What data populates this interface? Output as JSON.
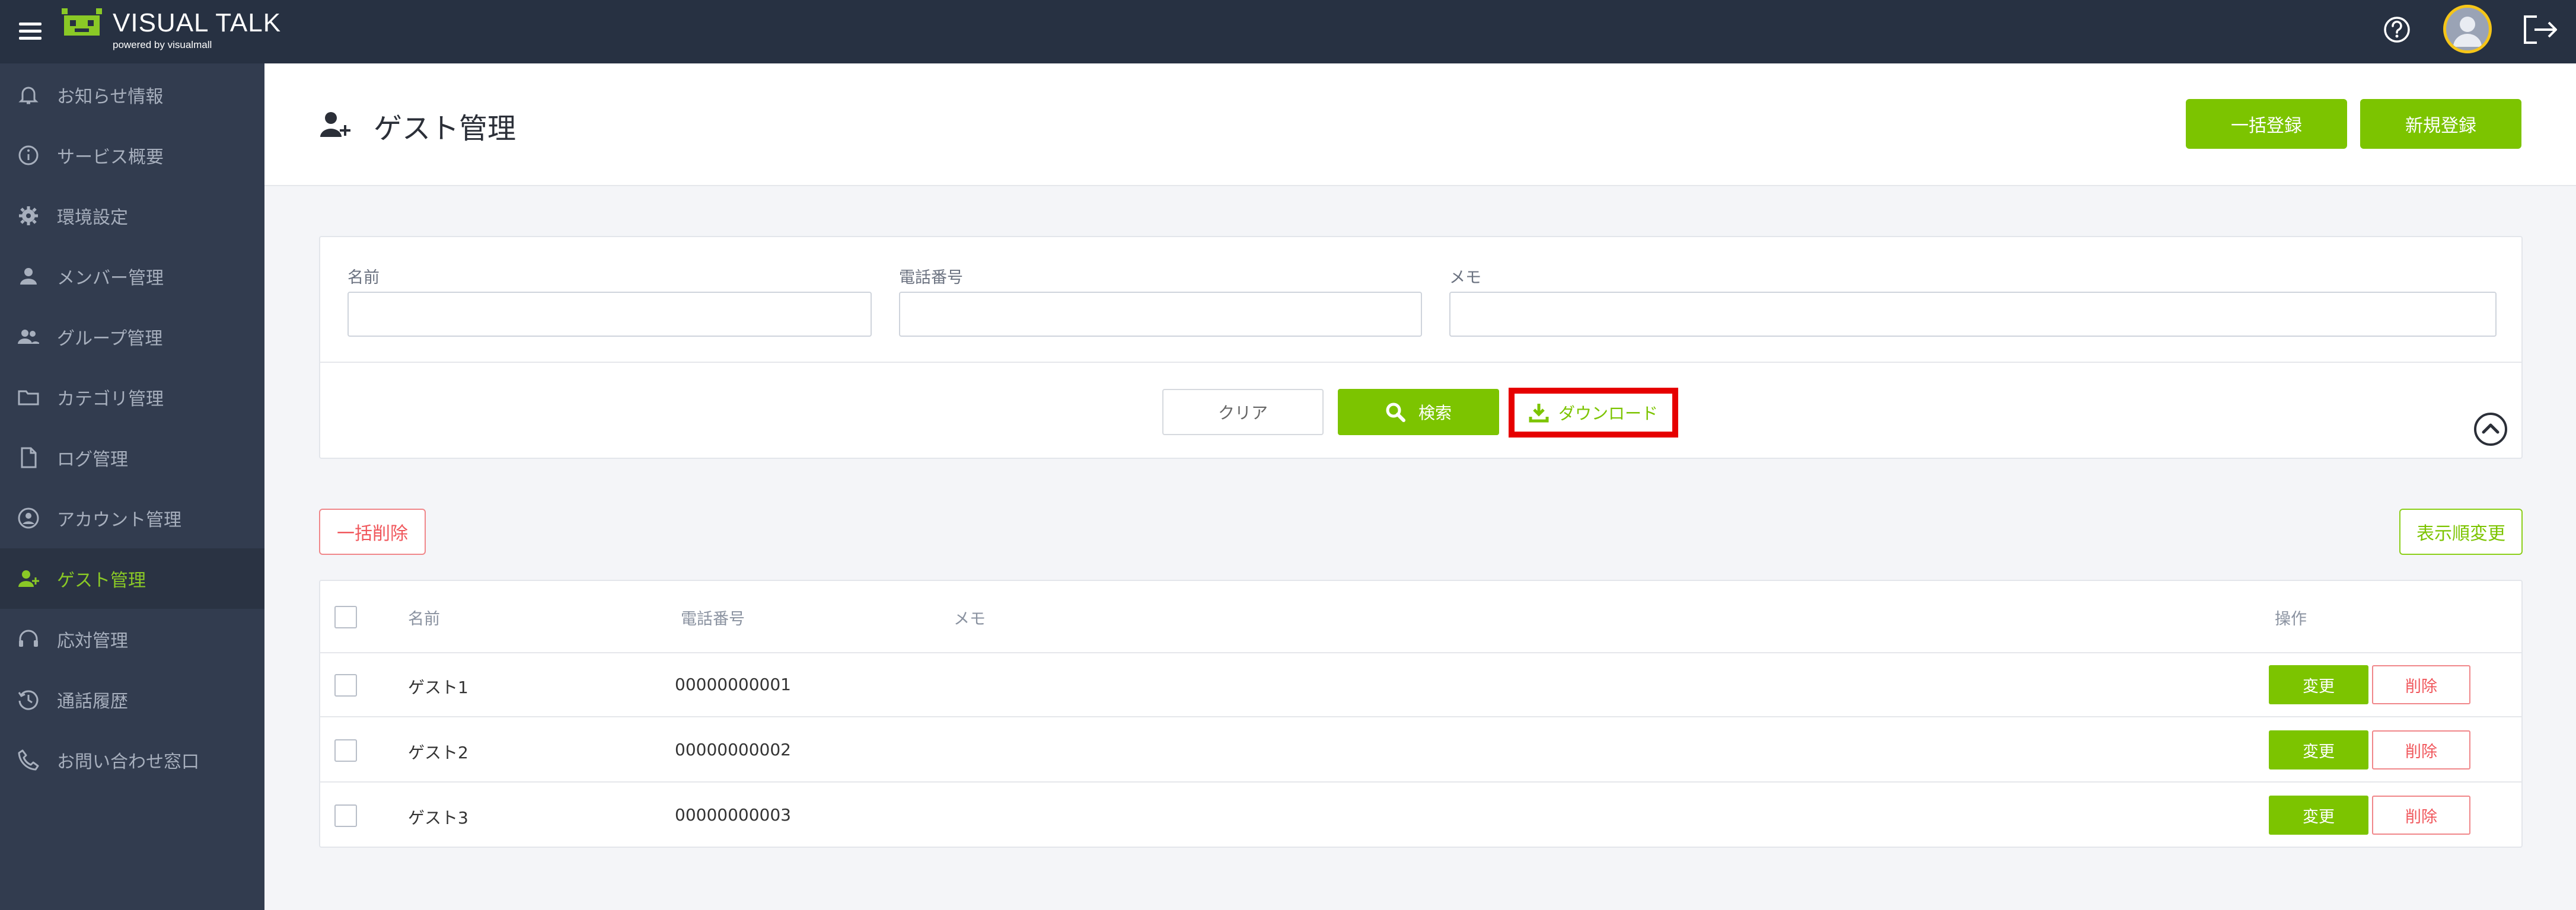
{
  "brand": {
    "title": "VISUAL TALK",
    "subtitle": "powered by visualmall"
  },
  "header_icons": {
    "menu": "hamburger-menu-icon",
    "help": "question-circle-icon",
    "avatar": "user-avatar",
    "logout": "logout-icon"
  },
  "sidebar": {
    "items": [
      {
        "label": "お知らせ情報",
        "icon": "bell-icon"
      },
      {
        "label": "サービス概要",
        "icon": "info-icon"
      },
      {
        "label": "環境設定",
        "icon": "gear-icon"
      },
      {
        "label": "メンバー管理",
        "icon": "person-icon"
      },
      {
        "label": "グループ管理",
        "icon": "group-icon"
      },
      {
        "label": "カテゴリ管理",
        "icon": "folder-icon"
      },
      {
        "label": "ログ管理",
        "icon": "document-icon"
      },
      {
        "label": "アカウント管理",
        "icon": "account-circle-icon"
      },
      {
        "label": "ゲスト管理",
        "icon": "person-add-icon",
        "active": true
      },
      {
        "label": "応対管理",
        "icon": "headset-icon"
      },
      {
        "label": "通話履歴",
        "icon": "history-icon"
      },
      {
        "label": "お問い合わせ窓口",
        "icon": "phone-icon"
      }
    ]
  },
  "page": {
    "title": "ゲスト管理",
    "bulk_register_label": "一括登録",
    "new_register_label": "新規登録"
  },
  "search": {
    "name_label": "名前",
    "name_value": "",
    "phone_label": "電話番号",
    "phone_value": "",
    "memo_label": "メモ",
    "memo_value": "",
    "clear_label": "クリア",
    "search_label": "検索",
    "download_label": "ダウンロード"
  },
  "list_actions": {
    "bulk_delete_label": "一括削除",
    "reorder_label": "表示順変更"
  },
  "table": {
    "headers": {
      "name": "名前",
      "phone": "電話番号",
      "memo": "メモ",
      "actions": "操作"
    },
    "edit_label": "変更",
    "delete_label": "削除",
    "rows": [
      {
        "name": "ゲスト1",
        "phone": "00000000001",
        "memo": ""
      },
      {
        "name": "ゲスト2",
        "phone": "00000000002",
        "memo": ""
      },
      {
        "name": "ゲスト3",
        "phone": "00000000003",
        "memo": ""
      }
    ]
  },
  "colors": {
    "accent_green": "#7cc400",
    "header_bg": "#273142",
    "sidebar_bg": "#323c4f",
    "danger": "#f0575c",
    "highlight_red": "#e60000"
  }
}
